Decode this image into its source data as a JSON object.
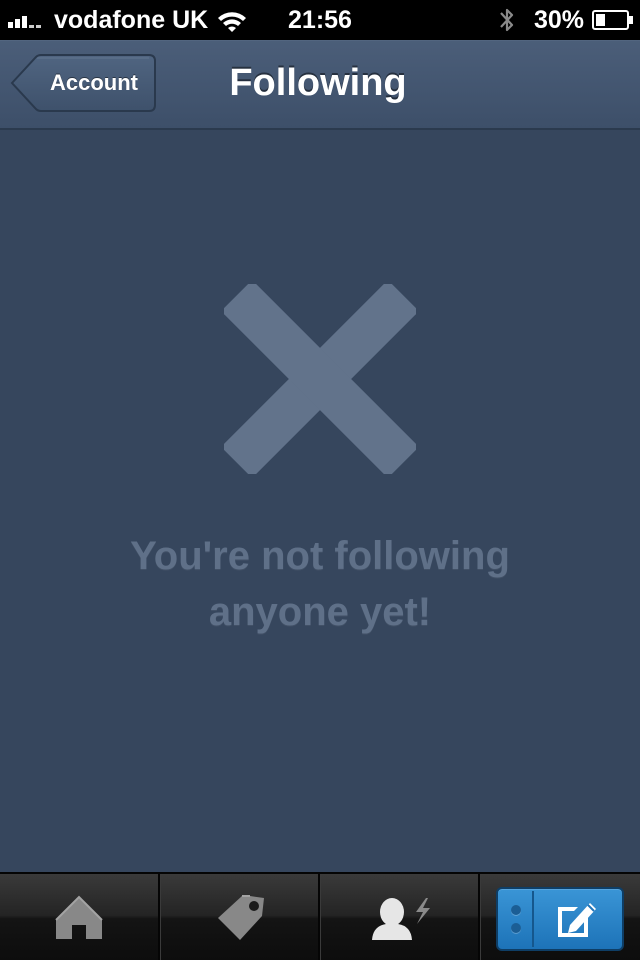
{
  "status_bar": {
    "carrier": "vodafone UK",
    "time": "21:56",
    "battery_percent_label": "30%",
    "battery_level": 0.3
  },
  "nav": {
    "back_label": "Account",
    "title": "Following"
  },
  "empty_state": {
    "icon": "x-icon",
    "line1": "You're not following",
    "line2": "anyone yet!"
  },
  "tabs": [
    {
      "icon": "home-icon"
    },
    {
      "icon": "tag-icon"
    },
    {
      "icon": "user-activity-icon"
    },
    {
      "icon": "compose-icon"
    }
  ],
  "colors": {
    "background": "#36465d",
    "accent": "#2a86cc",
    "empty_text": "#5f7088"
  }
}
